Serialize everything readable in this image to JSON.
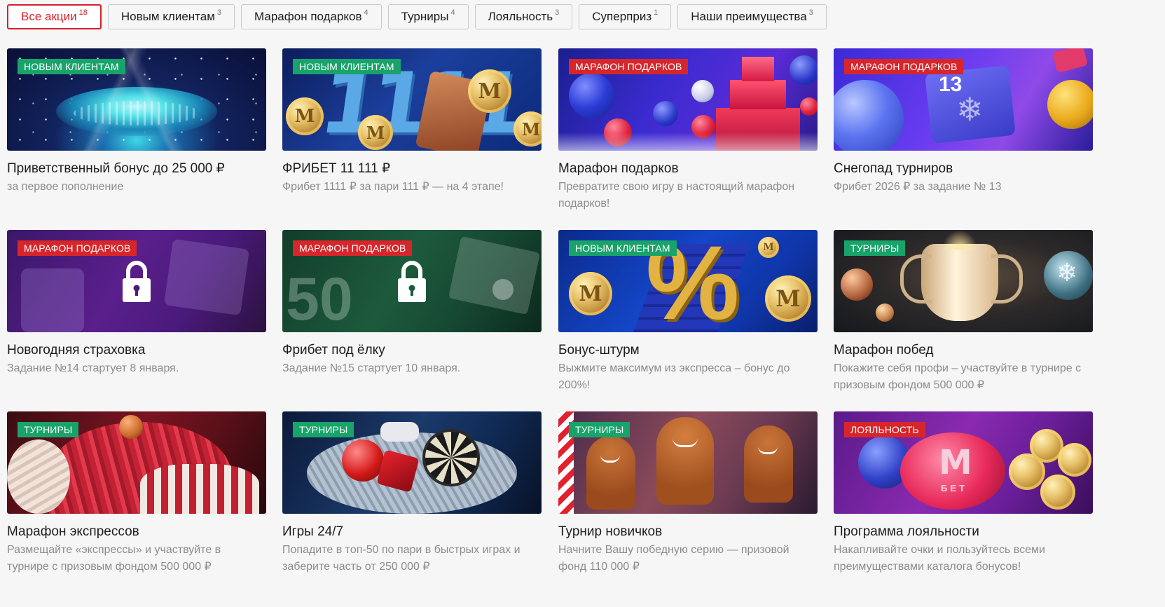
{
  "tabs": [
    {
      "label": "Все акции",
      "count": "18",
      "active": true
    },
    {
      "label": "Новым клиентам",
      "count": "3"
    },
    {
      "label": "Марафон подарков",
      "count": "4"
    },
    {
      "label": "Турниры",
      "count": "4"
    },
    {
      "label": "Лояльность",
      "count": "3"
    },
    {
      "label": "Суперприз",
      "count": "1"
    },
    {
      "label": "Наши преимущества",
      "count": "3"
    }
  ],
  "promos": [
    {
      "tag": "НОВЫМ КЛИЕНТАМ",
      "tag_color": "#19a36b",
      "title": "Приветственный бонус до 25 000 ₽",
      "desc": "за первое пополнение"
    },
    {
      "tag": "НОВЫМ КЛИЕНТАМ",
      "tag_color": "#19a36b",
      "title": "ФРИБЕТ 11 111 ₽",
      "desc": "Фрибет 1111 ₽ за пари 111 ₽ — на 4 этапе!"
    },
    {
      "tag": "МАРАФОН ПОДАРКОВ",
      "tag_color": "#d7262b",
      "title": "Марафон подарков",
      "desc": "Превратите свою игру в настоящий марафон подарков!"
    },
    {
      "tag": "МАРАФОН ПОДАРКОВ",
      "tag_color": "#d7262b",
      "title": "Снегопад турниров",
      "desc": "Фрибет 2026 ₽ за задание № 13"
    },
    {
      "tag": "МАРАФОН ПОДАРКОВ",
      "tag_color": "#d7262b",
      "title": "Новогодняя страховка",
      "desc": "Задание №14 стартует 8 января."
    },
    {
      "tag": "МАРАФОН ПОДАРКОВ",
      "tag_color": "#d7262b",
      "title": "Фрибет под ёлку",
      "desc": "Задание №15 стартует 10 января."
    },
    {
      "tag": "НОВЫМ КЛИЕНТАМ",
      "tag_color": "#19a36b",
      "title": "Бонус-штурм",
      "desc": "Выжмите максимум из экспресса – бонус до 200%!"
    },
    {
      "tag": "ТУРНИРЫ",
      "tag_color": "#19a36b",
      "title": "Марафон побед",
      "desc": "Покажите себя профи – участвуйте в турнире с призовым фондом 500 000 ₽"
    },
    {
      "tag": "ТУРНИРЫ",
      "tag_color": "#19a36b",
      "title": "Марафон экспрессов",
      "desc": "Размещайте «экспрессы» и участвуйте в турнире с призовым фондом 500 000 ₽"
    },
    {
      "tag": "ТУРНИРЫ",
      "tag_color": "#19a36b",
      "title": "Игры 24/7",
      "desc": "Попадите в топ-50 по пари в быстрых играх и заберите часть от 250 000 ₽"
    },
    {
      "tag": "ТУРНИРЫ",
      "tag_color": "#19a36b",
      "title": "Турнир новичков",
      "desc": "Начните Вашу победную серию — призовой фонд 110 000 ₽"
    },
    {
      "tag": "ЛОЯЛЬНОСТЬ",
      "tag_color": "#d7262b",
      "title": "Программа лояльности",
      "desc": "Накапливайте очки и пользуйтесь всеми преимуществами каталога бонусов!"
    }
  ],
  "banner_art": {
    "coin_letter": "M",
    "big_digits": "1111",
    "snow_number": "13",
    "fifty": "50",
    "percent": "%",
    "piggy_brand": "M",
    "piggy_sub": "БЕТ"
  },
  "colors": {
    "accent": "#d61f28",
    "tag_green": "#19a36b",
    "tag_red": "#d7262b"
  }
}
